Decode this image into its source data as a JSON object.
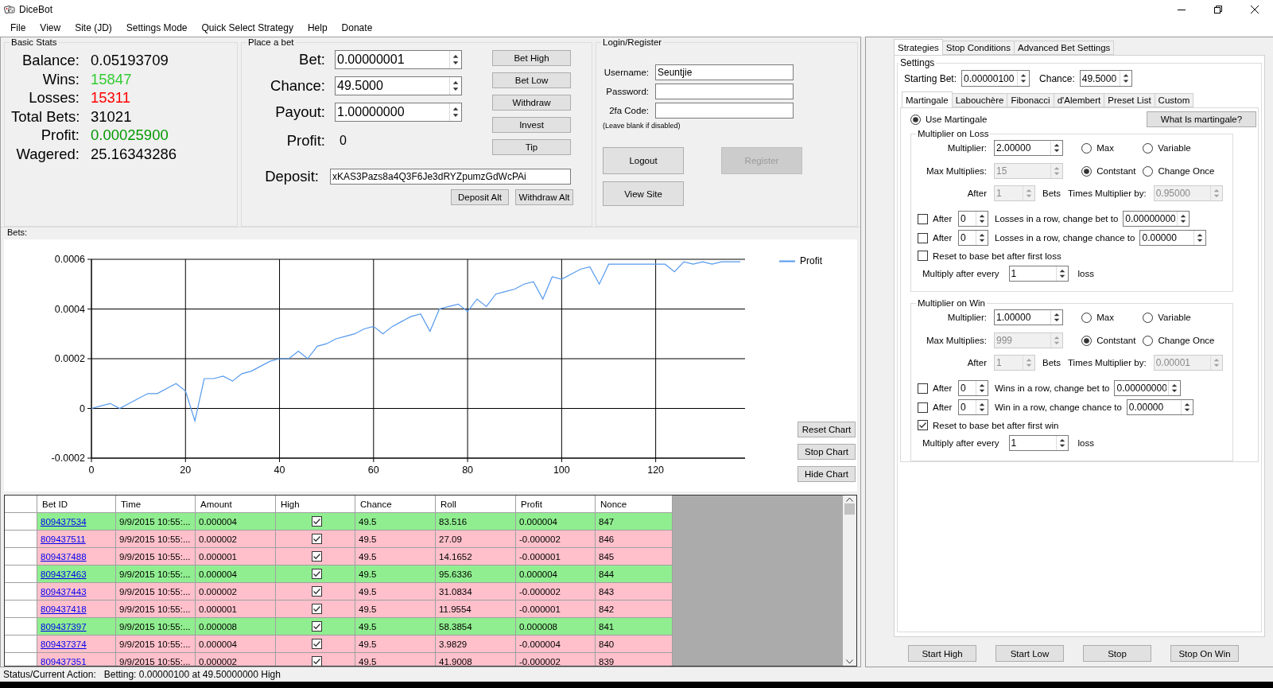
{
  "window": {
    "title": "DiceBot"
  },
  "menu": [
    "File",
    "View",
    "Site (JD)",
    "Settings Mode",
    "Quick Select Strategy",
    "Help",
    "Donate"
  ],
  "basic_stats": {
    "title": "Basic Stats",
    "rows": [
      {
        "label": "Balance:",
        "value": "0.05193709",
        "color": "#000000"
      },
      {
        "label": "Wins:",
        "value": "15847",
        "color": "#33cc33"
      },
      {
        "label": "Losses:",
        "value": "15311",
        "color": "#ff0000"
      },
      {
        "label": "Total Bets:",
        "value": "31021",
        "color": "#000000"
      },
      {
        "label": "Profit:",
        "value": "0.00025900",
        "color": "#009900"
      },
      {
        "label": "Wagered:",
        "value": "25.16343286",
        "color": "#000000"
      }
    ]
  },
  "place_bet": {
    "title": "Place a bet",
    "fields": [
      {
        "label": "Bet:",
        "value": "0.00000001"
      },
      {
        "label": "Chance:",
        "value": "49.5000"
      },
      {
        "label": "Payout:",
        "value": "1.00000000"
      }
    ],
    "profit": {
      "label": "Profit:",
      "value": "0"
    },
    "buttons": [
      "Bet High",
      "Bet Low",
      "Withdraw",
      "Invest",
      "Tip"
    ],
    "deposit": {
      "label": "Deposit:",
      "value": "xKAS3Pazs8a4Q3F6Je3dRYZpumzGdWcPAi"
    },
    "alt_buttons": [
      "Deposit Alt",
      "Withdraw Alt"
    ]
  },
  "login": {
    "title": "Login/Register",
    "fields": [
      {
        "label": "Username:",
        "value": "Seuntjie"
      },
      {
        "label": "Password:"
      },
      {
        "label": "2fa Code:"
      }
    ],
    "hint": "(Leave blank if disabled)",
    "buttons": [
      {
        "label": "Logout",
        "disabled": false
      },
      {
        "label": "Register",
        "disabled": true
      },
      {
        "label": "View Site",
        "disabled": false
      }
    ]
  },
  "chart_section": {
    "title": "Bets:",
    "buttons": [
      "Reset Chart",
      "Stop Chart",
      "Hide Chart"
    ],
    "chart_data": {
      "type": "line",
      "grid": true,
      "xlim": [
        0,
        139
      ],
      "ylim": [
        -0.0002,
        0.0006
      ],
      "xticks": [
        0,
        20,
        40,
        60,
        80,
        100,
        120
      ],
      "yticks": [
        -0.0002,
        0,
        0.0002,
        0.0004,
        0.0006
      ],
      "x": [
        0,
        2,
        4,
        6,
        8,
        10,
        12,
        14,
        16,
        18,
        20,
        22,
        24,
        26,
        28,
        30,
        32,
        34,
        36,
        38,
        40,
        42,
        44,
        46,
        48,
        50,
        52,
        54,
        56,
        58,
        60,
        62,
        64,
        66,
        68,
        70,
        72,
        74,
        76,
        78,
        80,
        82,
        84,
        86,
        88,
        90,
        92,
        94,
        96,
        98,
        100,
        102,
        104,
        106,
        108,
        110,
        112,
        114,
        116,
        118,
        120,
        122,
        124,
        126,
        128,
        130,
        132,
        134,
        136,
        138
      ],
      "series": [
        {
          "name": "Profit",
          "color": "#5599ee",
          "values": [
            0,
            1e-05,
            2e-05,
            0,
            2e-05,
            4e-05,
            6e-05,
            6e-05,
            8e-05,
            0.0001,
            7e-05,
            -5e-05,
            0.00012,
            0.00012,
            0.00013,
            0.00011,
            0.00014,
            0.00015,
            0.00017,
            0.00019,
            0.0002,
            0.0002,
            0.00023,
            0.0002,
            0.00025,
            0.00026,
            0.00028,
            0.00029,
            0.0003,
            0.00032,
            0.00033,
            0.0003,
            0.00033,
            0.00035,
            0.00037,
            0.00038,
            0.00031,
            0.0004,
            0.00041,
            0.00042,
            0.00039,
            0.00044,
            0.00041,
            0.00046,
            0.00047,
            0.00048,
            0.0005,
            0.00051,
            0.00044,
            0.00053,
            0.00052,
            0.00054,
            0.00056,
            0.00057,
            0.0005,
            0.00058,
            0.00058,
            0.00058,
            0.00058,
            0.00058,
            0.00058,
            0.00058,
            0.00055,
            0.00059,
            0.00058,
            0.00059,
            0.00058,
            0.00059,
            0.00059,
            0.00059
          ]
        }
      ]
    }
  },
  "bets_table": {
    "columns": [
      "Bet ID",
      "Time",
      "Amount",
      "High",
      "Chance",
      "Roll",
      "Profit",
      "Nonce"
    ],
    "rows": [
      {
        "bet_id": "809437534",
        "time": "9/9/2015 10:55:...",
        "amount": "0.000004",
        "high": true,
        "chance": "49.5",
        "roll": "83.516",
        "profit": "0.000004",
        "nonce": "847",
        "win": true
      },
      {
        "bet_id": "809437511",
        "time": "9/9/2015 10:55:...",
        "amount": "0.000002",
        "high": true,
        "chance": "49.5",
        "roll": "27.09",
        "profit": "-0.000002",
        "nonce": "846",
        "win": false
      },
      {
        "bet_id": "809437488",
        "time": "9/9/2015 10:55:...",
        "amount": "0.000001",
        "high": true,
        "chance": "49.5",
        "roll": "14.1652",
        "profit": "-0.000001",
        "nonce": "845",
        "win": false
      },
      {
        "bet_id": "809437463",
        "time": "9/9/2015 10:55:...",
        "amount": "0.000004",
        "high": true,
        "chance": "49.5",
        "roll": "95.6336",
        "profit": "0.000004",
        "nonce": "844",
        "win": true
      },
      {
        "bet_id": "809437443",
        "time": "9/9/2015 10:55:...",
        "amount": "0.000002",
        "high": true,
        "chance": "49.5",
        "roll": "31.0834",
        "profit": "-0.000002",
        "nonce": "843",
        "win": false
      },
      {
        "bet_id": "809437418",
        "time": "9/9/2015 10:55:...",
        "amount": "0.000001",
        "high": true,
        "chance": "49.5",
        "roll": "11.9554",
        "profit": "-0.000001",
        "nonce": "842",
        "win": false
      },
      {
        "bet_id": "809437397",
        "time": "9/9/2015 10:55:...",
        "amount": "0.000008",
        "high": true,
        "chance": "49.5",
        "roll": "58.3854",
        "profit": "0.000008",
        "nonce": "841",
        "win": true
      },
      {
        "bet_id": "809437374",
        "time": "9/9/2015 10:55:...",
        "amount": "0.000004",
        "high": true,
        "chance": "49.5",
        "roll": "3.9829",
        "profit": "-0.000004",
        "nonce": "840",
        "win": false
      },
      {
        "bet_id": "809437351",
        "time": "9/9/2015 10:55:...",
        "amount": "0.000002",
        "high": true,
        "chance": "49.5",
        "roll": "41.9008",
        "profit": "-0.000002",
        "nonce": "839",
        "win": false
      }
    ]
  },
  "status_bar": {
    "label": "Status/Current Action:",
    "value": "Betting: 0.00000100 at 49.50000000 High"
  },
  "strategy_panel": {
    "tabs": [
      {
        "label": "Strategies",
        "selected": true
      },
      {
        "label": "Stop Conditions",
        "selected": false
      },
      {
        "label": "Advanced Bet Settings",
        "selected": false
      }
    ],
    "settings_title": "Settings",
    "starting_bet": {
      "label": "Starting Bet:",
      "value": "0.00000100"
    },
    "chance": {
      "label": "Chance:",
      "value": "49.5000"
    },
    "strategy_tabs": [
      {
        "label": "Martingale",
        "selected": true
      },
      {
        "label": "Labouchère",
        "selected": false
      },
      {
        "label": "Fibonacci",
        "selected": false
      },
      {
        "label": "d'Alembert",
        "selected": false
      },
      {
        "label": "Preset List",
        "selected": false
      },
      {
        "label": "Custom",
        "selected": false
      }
    ],
    "use_martingale": {
      "label": "Use Martingale",
      "selected": true
    },
    "help_button": "What Is martingale?",
    "groups": [
      {
        "title": "Multiplier on Loss",
        "multiplier": {
          "label": "Multiplier:",
          "value": "2.00000",
          "disabled": false
        },
        "max_multiplies": {
          "label": "Max Multiplies:",
          "value": "15",
          "disabled": true
        },
        "after": {
          "label": "After",
          "value": "1",
          "disabled": true
        },
        "bets_label": "Bets",
        "times_multiplier": {
          "label": "Times Multiplier by:",
          "value": "0.95000",
          "disabled": true
        },
        "modes": [
          {
            "label": "Max",
            "selected": false
          },
          {
            "label": "Variable",
            "selected": false
          },
          {
            "label": "Contstant",
            "selected": true
          },
          {
            "label": "Change Once",
            "selected": false
          }
        ],
        "change_rows": [
          {
            "checked": false,
            "label": "After",
            "count": "0",
            "text": "Losses in a row, change bet to",
            "value": "0.00000000"
          },
          {
            "checked": false,
            "label": "After",
            "count": "0",
            "text": "Losses in a row, change chance to",
            "value": "0.00000"
          }
        ],
        "reset": {
          "label": "Reset to base bet after first loss",
          "checked": false
        },
        "multiply_every": {
          "label": "Multiply after every",
          "value": "1",
          "unit": "loss"
        }
      },
      {
        "title": "Multiplier on Win",
        "multiplier": {
          "label": "Multiplier:",
          "value": "1.00000",
          "disabled": false
        },
        "max_multiplies": {
          "label": "Max Multiplies:",
          "value": "999",
          "disabled": true
        },
        "after": {
          "label": "After",
          "value": "1",
          "disabled": true
        },
        "bets_label": "Bets",
        "times_multiplier": {
          "label": "Times Multiplier by:",
          "value": "0.00001",
          "disabled": true
        },
        "modes": [
          {
            "label": "Max",
            "selected": false
          },
          {
            "label": "Variable",
            "selected": false
          },
          {
            "label": "Contstant",
            "selected": true
          },
          {
            "label": "Change Once",
            "selected": false
          }
        ],
        "change_rows": [
          {
            "checked": false,
            "label": "After",
            "count": "0",
            "text": "Wins in a row, change bet to",
            "value": "0.00000000"
          },
          {
            "checked": false,
            "label": "After",
            "count": "0",
            "text": "Win in a row, change chance to",
            "value": "0.00000"
          }
        ],
        "reset": {
          "label": "Reset to base bet after first win",
          "checked": true
        },
        "multiply_every": {
          "label": "Multiply after every",
          "value": "1",
          "unit": "loss"
        }
      }
    ],
    "action_buttons": [
      "Start High",
      "Start Low",
      "Stop",
      "Stop On Win"
    ]
  }
}
